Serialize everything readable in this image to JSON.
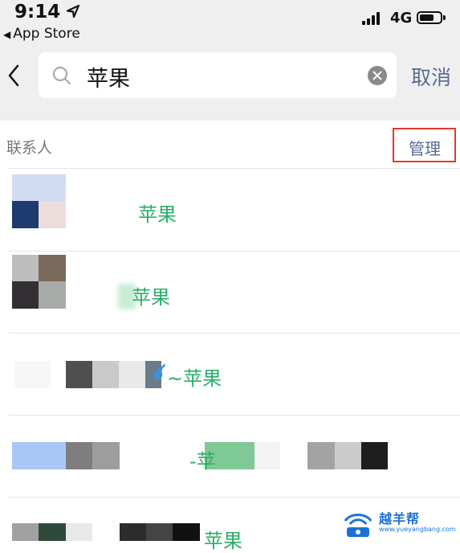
{
  "status_bar": {
    "time": "9:14",
    "network": "4G",
    "back_app": "App Store",
    "battery_level": 0.7
  },
  "search": {
    "query": "苹果",
    "cancel_label": "取消"
  },
  "contacts_section": {
    "title": "联系人",
    "manage_label": "管理"
  },
  "results": [
    {
      "name_fragment": "苹果"
    },
    {
      "name_fragment": "苹果"
    },
    {
      "name_fragment": "~苹果"
    },
    {
      "name_fragment": "-苹"
    },
    {
      "name_fragment": "苹果"
    }
  ],
  "colors": {
    "accent_link": "#576b95",
    "highlight_green": "#2aae67",
    "annotation_box": "#e23a2a",
    "header_bg": "#efefef"
  },
  "icons": [
    "location-arrow-icon",
    "signal-icon",
    "battery-icon",
    "back-chevron-icon",
    "search-icon",
    "clear-icon"
  ],
  "watermark": {
    "title": "越羊帮",
    "url": "www.yueyangbang.com"
  }
}
